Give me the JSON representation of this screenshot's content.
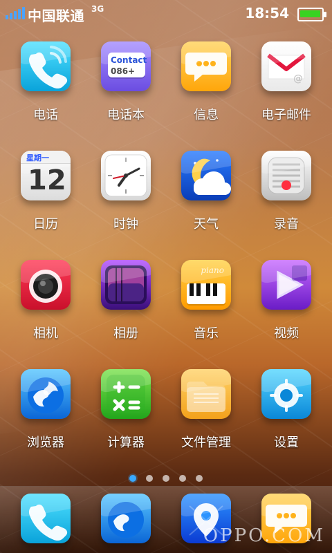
{
  "status_bar": {
    "carrier": "中国联通",
    "network": "3G",
    "time": "18:54",
    "battery_level_percent": 95,
    "colors": {
      "signal": "#4aa3ff",
      "battery": "#39d321"
    }
  },
  "home": {
    "apps": [
      {
        "label": "电话",
        "icon": "phone-icon"
      },
      {
        "label": "电话本",
        "icon": "contacts-icon",
        "icon_text": [
          "Contact",
          "086+"
        ]
      },
      {
        "label": "信息",
        "icon": "messages-icon"
      },
      {
        "label": "电子邮件",
        "icon": "mail-icon",
        "icon_text": [
          "@"
        ]
      },
      {
        "label": "日历",
        "icon": "calendar-icon",
        "icon_text": [
          "星期一",
          "12"
        ]
      },
      {
        "label": "时钟",
        "icon": "clock-icon"
      },
      {
        "label": "天气",
        "icon": "weather-icon"
      },
      {
        "label": "录音",
        "icon": "recorder-icon"
      },
      {
        "label": "相机",
        "icon": "camera-icon"
      },
      {
        "label": "相册",
        "icon": "album-icon"
      },
      {
        "label": "音乐",
        "icon": "music-icon",
        "icon_text": [
          "piano"
        ]
      },
      {
        "label": "视频",
        "icon": "video-icon"
      },
      {
        "label": "浏览器",
        "icon": "browser-icon"
      },
      {
        "label": "计算器",
        "icon": "calculator-icon"
      },
      {
        "label": "文件管理",
        "icon": "file-manager-icon"
      },
      {
        "label": "设置",
        "icon": "settings-icon"
      }
    ],
    "page_indicator": {
      "pages": 5,
      "active_index": 0
    }
  },
  "dock": {
    "apps": [
      {
        "icon": "phone-icon"
      },
      {
        "icon": "browser-icon"
      },
      {
        "icon": "maps-icon"
      },
      {
        "icon": "messages-icon"
      }
    ],
    "brand": "OPPO.COM"
  }
}
